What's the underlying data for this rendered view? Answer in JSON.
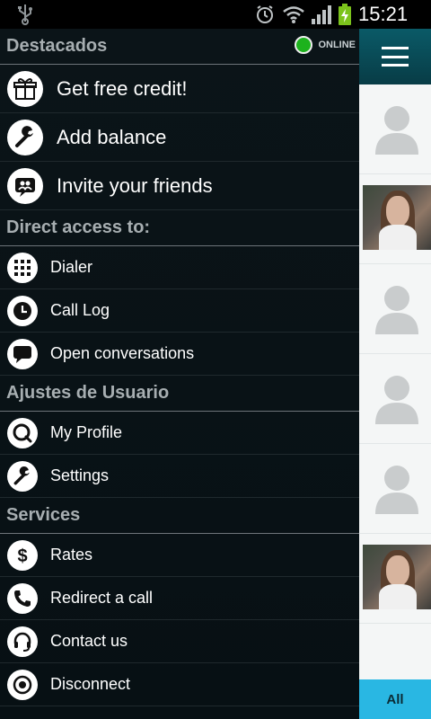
{
  "status_bar": {
    "time": "15:21"
  },
  "drawer": {
    "sections": [
      {
        "title": "Destacados",
        "online_label": "ONLINE",
        "size": "big",
        "items": [
          {
            "label": "Get free credit!",
            "icon": "gift-icon"
          },
          {
            "label": "Add balance",
            "icon": "wrench-icon"
          },
          {
            "label": "Invite your friends",
            "icon": "invite-friends-icon"
          }
        ]
      },
      {
        "title": "Direct access to:",
        "size": "normal",
        "items": [
          {
            "label": "Dialer",
            "icon": "dialpad-icon"
          },
          {
            "label": "Call Log",
            "icon": "clock-icon"
          },
          {
            "label": "Open conversations",
            "icon": "chat-bubble-icon"
          }
        ]
      },
      {
        "title": "Ajustes de Usuario",
        "size": "normal",
        "items": [
          {
            "label": "My Profile",
            "icon": "profile-icon"
          },
          {
            "label": "Settings",
            "icon": "wrench-icon"
          }
        ]
      },
      {
        "title": "Services",
        "size": "normal",
        "items": [
          {
            "label": "Rates",
            "icon": "dollar-icon"
          },
          {
            "label": "Redirect a call",
            "icon": "phone-icon"
          },
          {
            "label": "Contact us",
            "icon": "headset-icon"
          },
          {
            "label": "Disconnect",
            "icon": "disconnect-icon"
          }
        ]
      }
    ]
  },
  "right_panel": {
    "menu_icon": "hamburger-menu-icon",
    "contacts": [
      "default-avatar",
      "photo",
      "default-avatar",
      "default-avatar",
      "default-avatar",
      "photo"
    ],
    "tab_label": "All"
  },
  "colors": {
    "online": "#1db21d",
    "accent": "#29b7e3",
    "header_bar": "#0a5a67"
  }
}
